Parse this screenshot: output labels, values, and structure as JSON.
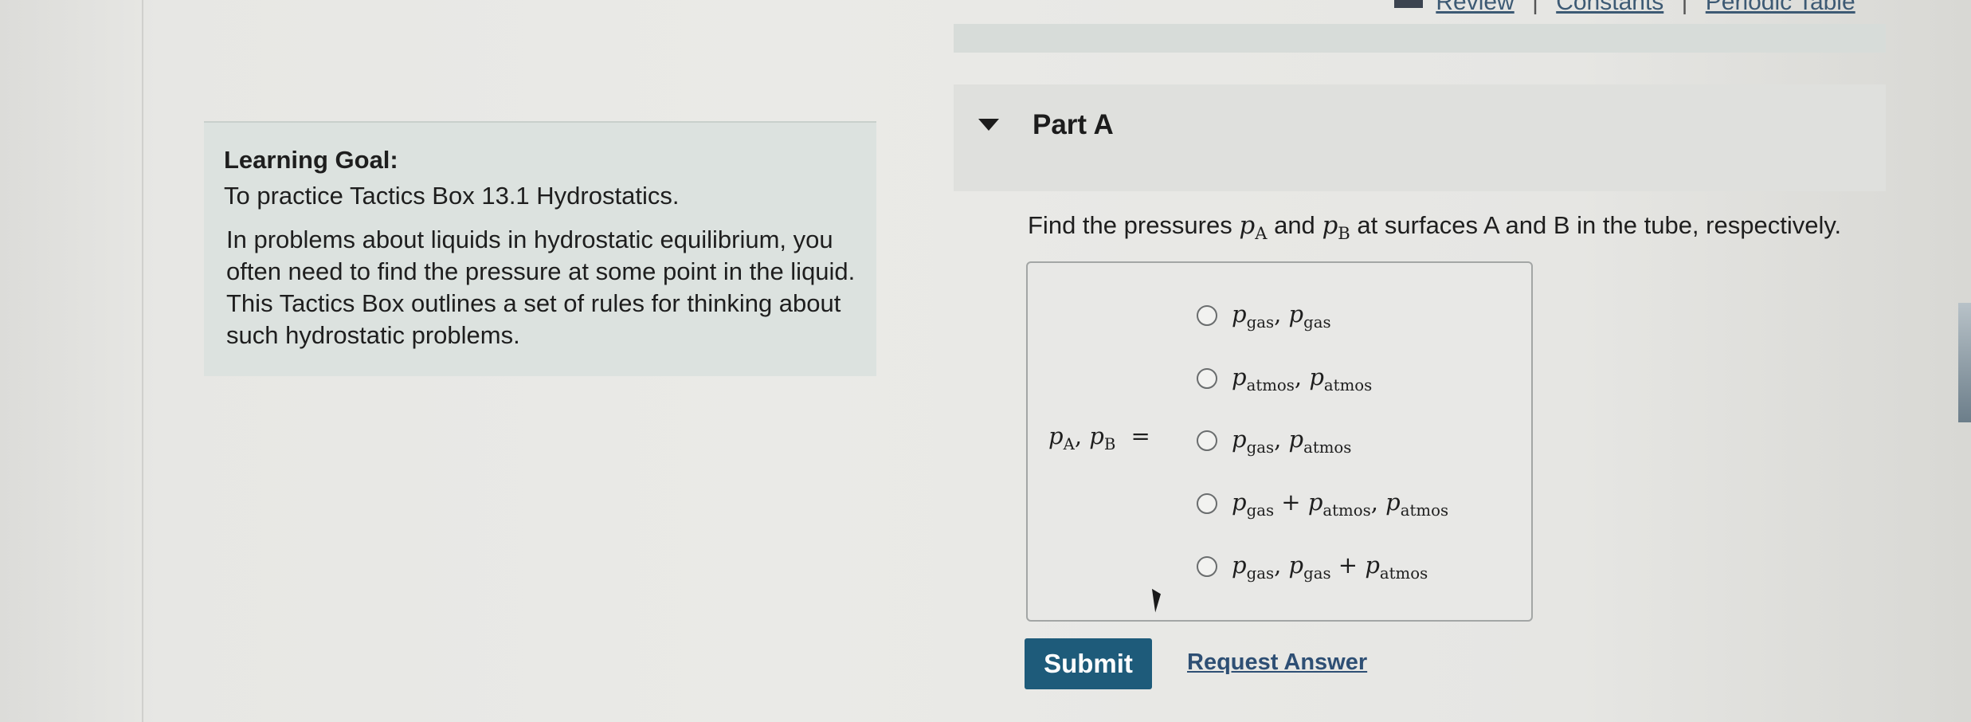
{
  "header": {
    "links": [
      "Review",
      "Constants",
      "Periodic Table"
    ],
    "separator": "|"
  },
  "learning_goal": {
    "heading": "Learning Goal:",
    "subheading": "To practice Tactics Box 13.1 Hydrostatics.",
    "body": "In problems about liquids in hydrostatic equilibrium, you often need to find the pressure at some point in the liquid. This Tactics Box outlines a set of rules for thinking about such hydrostatic problems."
  },
  "part": {
    "title": "Part A",
    "question_pre": "Find the pressures",
    "question_mid": "and",
    "question_post": "at surfaces A and B in the tube, respectively.",
    "var_a": "p",
    "sub_a": "A",
    "var_b": "p",
    "sub_b": "B"
  },
  "answer": {
    "label_vars": "p",
    "label_sub_a": "A",
    "label_sub_b": "B",
    "equals": "=",
    "options": [
      {
        "text": "p_gas, p_gas"
      },
      {
        "text": "p_atmos, p_atmos"
      },
      {
        "text": "p_gas, p_atmos"
      },
      {
        "text": "p_gas + p_atmos, p_atmos"
      },
      {
        "text": "p_gas, p_gas + p_atmos"
      }
    ]
  },
  "actions": {
    "submit_label": "Submit",
    "request_label": "Request Answer"
  }
}
